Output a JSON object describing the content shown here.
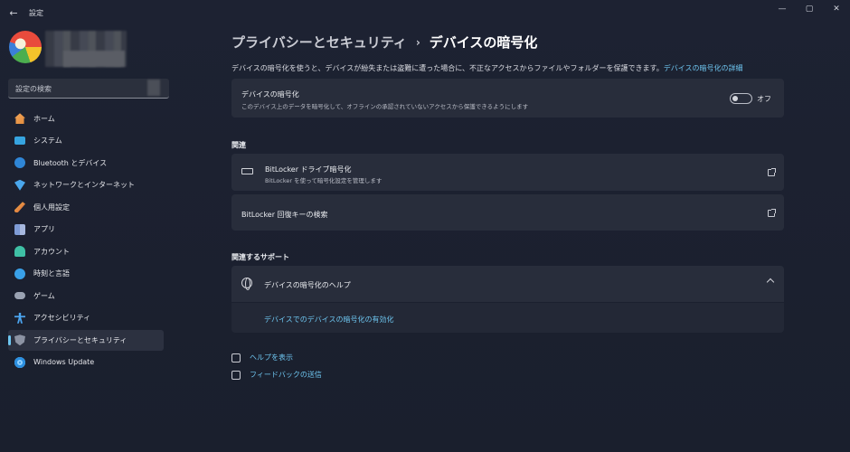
{
  "window": {
    "back_label": "←",
    "title": "設定",
    "controls": {
      "minimize": "—",
      "maximize": "▢",
      "close": "✕"
    }
  },
  "sidebar": {
    "search_placeholder": "設定の検索",
    "items": [
      {
        "label": "ホーム",
        "icon": "home-icon"
      },
      {
        "label": "システム",
        "icon": "monitor-icon"
      },
      {
        "label": "Bluetooth とデバイス",
        "icon": "bluetooth-icon"
      },
      {
        "label": "ネットワークとインターネット",
        "icon": "wifi-icon"
      },
      {
        "label": "個人用設定",
        "icon": "brush-icon"
      },
      {
        "label": "アプリ",
        "icon": "apps-icon"
      },
      {
        "label": "アカウント",
        "icon": "account-icon"
      },
      {
        "label": "時刻と言語",
        "icon": "globe-clock-icon"
      },
      {
        "label": "ゲーム",
        "icon": "gamepad-icon"
      },
      {
        "label": "アクセシビリティ",
        "icon": "accessibility-icon"
      },
      {
        "label": "プライバシーとセキュリティ",
        "icon": "shield-icon",
        "selected": true
      },
      {
        "label": "Windows Update",
        "icon": "update-icon"
      }
    ]
  },
  "header": {
    "parent": "プライバシーとセキュリティ",
    "separator": "›",
    "current": "デバイスの暗号化"
  },
  "description": {
    "text": "デバイスの暗号化を使うと、デバイスが紛失または盗難に遭った場合に、不正なアクセスからファイルやフォルダーを保護できます。",
    "link": "デバイスの暗号化の詳細"
  },
  "encryption_card": {
    "title": "デバイスの暗号化",
    "subtitle": "このデバイス上のデータを暗号化して、オフラインの承認されていないアクセスから保護できるようにします",
    "toggle_state": "オフ"
  },
  "related": {
    "heading": "関連",
    "bitlocker": {
      "title": "BitLocker ドライブ暗号化",
      "subtitle": "BitLocker を使って暗号化設定を管理します"
    },
    "recovery": {
      "title": "BitLocker 回復キーの検索"
    }
  },
  "support": {
    "heading": "関連するサポート",
    "help_title": "デバイスの暗号化のヘルプ",
    "help_link": "デバイスでのデバイスの暗号化の有効化"
  },
  "footer": {
    "help": "ヘルプを表示",
    "feedback": "フィードバックの送信"
  },
  "colors": {
    "accent": "#6ec6f0",
    "card": "#282d3b",
    "background": "#1c2130"
  }
}
